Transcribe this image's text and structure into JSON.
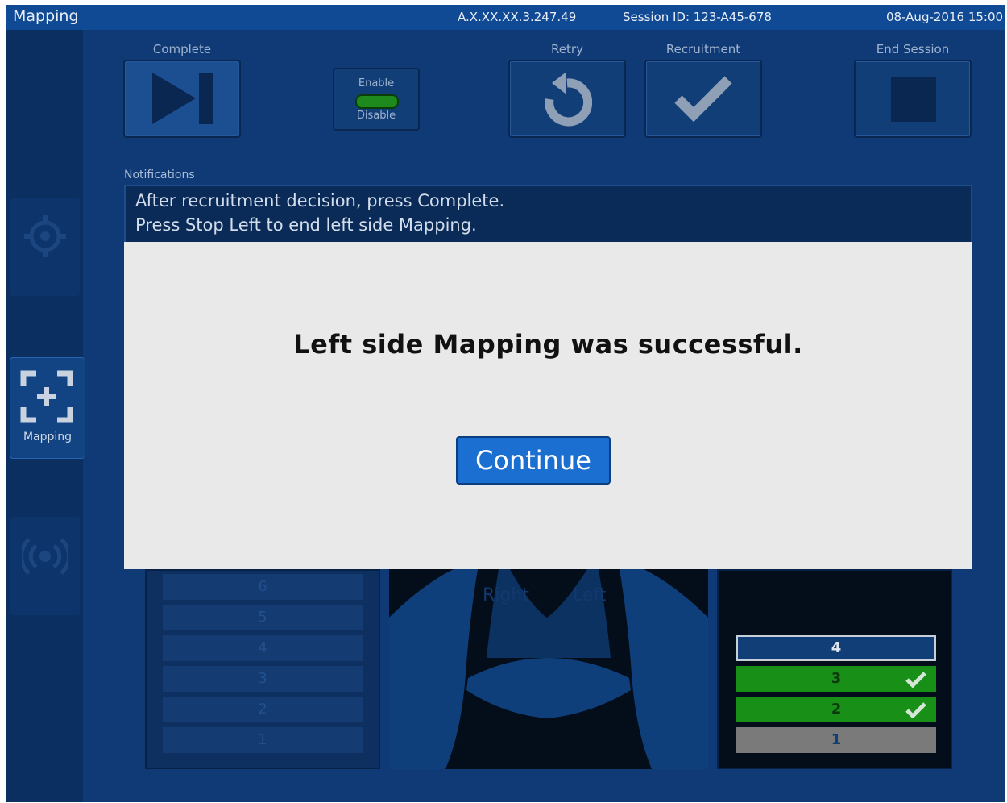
{
  "topbar": {
    "title": "Mapping",
    "ip": "A.X.XX.XX.3.247.49",
    "session": "Session ID: 123-A45-678",
    "datetime": "08-Aug-2016  15:00"
  },
  "sidebar": {
    "items": [
      {
        "label": "",
        "icon": "target-icon",
        "state": "disabled"
      },
      {
        "label": "Mapping",
        "icon": "mapping-icon",
        "state": "active"
      },
      {
        "label": "",
        "icon": "radio-waves-icon",
        "state": "disabled"
      }
    ]
  },
  "toolbar": {
    "complete_label": "Complete",
    "enable_label": "Enable",
    "disable_label": "Disable",
    "retry_label": "Retry",
    "recruitment_label": "Recruitment",
    "end_session_label": "End Session"
  },
  "notifications": {
    "label": "Notifications",
    "lines": [
      "After recruitment decision, press Complete.",
      "Press Stop Left to end left side Mapping."
    ]
  },
  "left_panel": {
    "lanes": [
      "6",
      "5",
      "4",
      "3",
      "2",
      "1"
    ]
  },
  "lung_view": {
    "right_label": "Right",
    "left_label": "Left"
  },
  "status_panel": {
    "rows": [
      {
        "label": "4",
        "state": "current",
        "checked": false
      },
      {
        "label": "3",
        "state": "done",
        "checked": true
      },
      {
        "label": "2",
        "state": "done",
        "checked": true
      },
      {
        "label": "1",
        "state": "inactive",
        "checked": false
      }
    ]
  },
  "dialog": {
    "message": "Left side Mapping was successful.",
    "button_label": "Continue"
  },
  "colors": {
    "background": "#0f3a75",
    "topbar": "#114a94",
    "accent_button": "#1b6fd1",
    "success_green": "#189018",
    "inactive_gray": "#7a7a7a"
  }
}
